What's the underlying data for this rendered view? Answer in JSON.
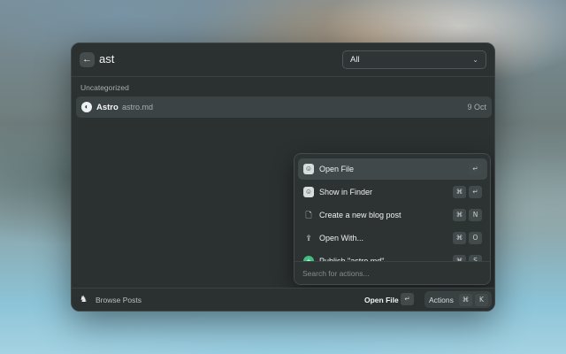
{
  "search": {
    "back_glyph": "←",
    "query": "ast",
    "filter_value": "All",
    "filter_chevron": "⌄"
  },
  "list": {
    "section_title": "Uncategorized",
    "items": [
      {
        "icon": "astro-logo-icon",
        "icon_glyph": "◐",
        "title": "Astro",
        "subtitle": "astro.md",
        "date": "9 Oct"
      }
    ]
  },
  "actions_panel": {
    "items": [
      {
        "icon": "finder-icon",
        "glyph": "☺",
        "label": "Open File",
        "keys": [
          "↵"
        ]
      },
      {
        "icon": "finder-icon",
        "glyph": "☺",
        "label": "Show in Finder",
        "keys": [
          "⌘",
          "↵"
        ]
      },
      {
        "icon": "new-document-icon",
        "glyph": "🗋",
        "label": "Create a new blog post",
        "keys": [
          "⌘",
          "N"
        ]
      },
      {
        "icon": "upload-icon",
        "glyph": "⇪",
        "label": "Open With...",
        "keys": [
          "⌘",
          "O"
        ]
      },
      {
        "icon": "publish-icon",
        "glyph": "+",
        "label": "Publish \"astro.md\"",
        "keys": [
          "⌘",
          "S"
        ]
      }
    ],
    "search_placeholder": "Search for actions..."
  },
  "footer": {
    "extension_icon_glyph": "♞",
    "extension_title": "Browse Posts",
    "primary_action": "Open File",
    "primary_key": "↵",
    "actions_label": "Actions",
    "actions_keys": [
      "⌘",
      "K"
    ]
  },
  "colors": {
    "window_bg": "#2b3031",
    "selected_bg": "#3c4344",
    "publish_green": "#3fbf7f"
  }
}
